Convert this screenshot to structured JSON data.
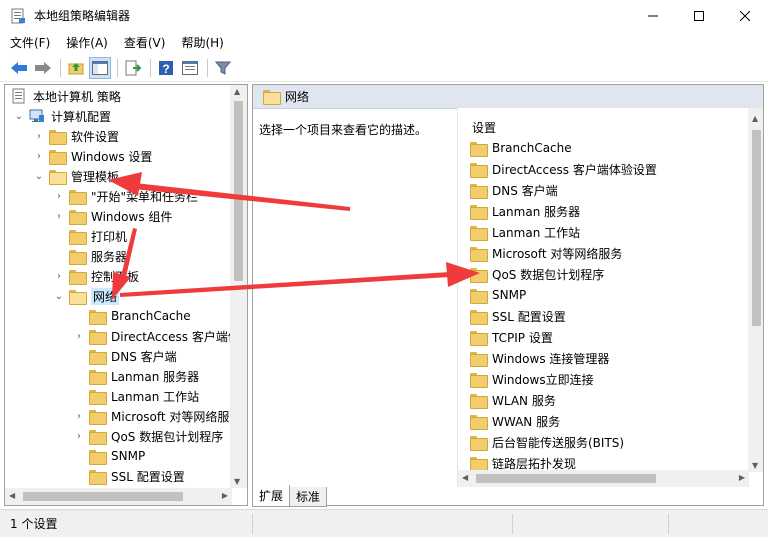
{
  "window": {
    "title": "本地组策略编辑器",
    "minimize_label": "—",
    "maximize_label": "☐",
    "close_label": "✕"
  },
  "menu": {
    "file": "文件(F)",
    "action": "操作(A)",
    "view": "查看(V)",
    "help": "帮助(H)"
  },
  "tree": {
    "root": "本地计算机 策略",
    "computer_config": "计算机配置",
    "software_settings": "软件设置",
    "windows_settings": "Windows 设置",
    "admin_templates": "管理模板",
    "start_menu": "\"开始\"菜单和任务栏",
    "windows_components": "Windows 组件",
    "printers": "打印机",
    "servers": "服务器",
    "control_panel": "控制面板",
    "network": "网络",
    "children": [
      "BranchCache",
      "DirectAccess 客户端体",
      "DNS 客户端",
      "Lanman 服务器",
      "Lanman 工作站",
      "Microsoft 对等网络服",
      "QoS 数据包计划程序",
      "SNMP",
      "SSL 配置设置"
    ]
  },
  "right": {
    "header": "网络",
    "description": "选择一个项目来查看它的描述。",
    "column_header": "设置",
    "items": [
      "BranchCache",
      "DirectAccess 客户端体验设置",
      "DNS 客户端",
      "Lanman 服务器",
      "Lanman 工作站",
      "Microsoft 对等网络服务",
      "QoS 数据包计划程序",
      "SNMP",
      "SSL 配置设置",
      "TCPIP 设置",
      "Windows 连接管理器",
      "Windows立即连接",
      "WLAN 服务",
      "WWAN 服务",
      "后台智能传送服务(BITS)",
      "链路层拓扑发现"
    ]
  },
  "tabs": {
    "extended": "扩展",
    "standard": "标准"
  },
  "status": {
    "text": "1 个设置"
  },
  "colors": {
    "annotation_arrow": "#ef3b3b",
    "selection": "#cce8ff",
    "header_bg": "#dfe6ef"
  }
}
